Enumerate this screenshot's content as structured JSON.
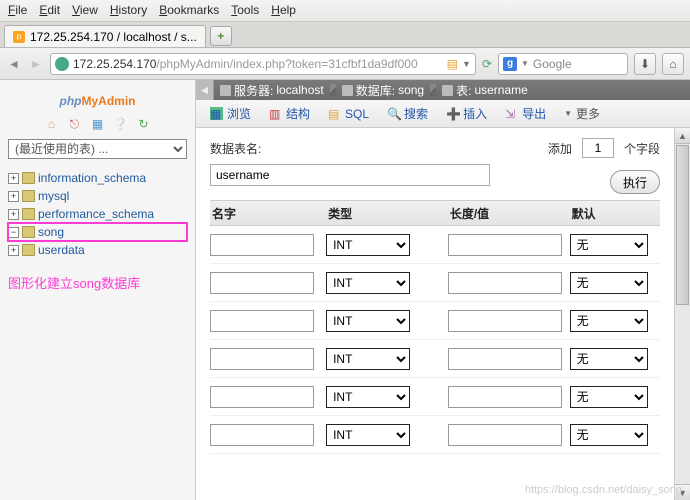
{
  "menu": {
    "file": "File",
    "edit": "Edit",
    "view": "View",
    "history": "History",
    "bookmarks": "Bookmarks",
    "tools": "Tools",
    "help": "Help"
  },
  "tab": {
    "title": "172.25.254.170 / localhost / s...",
    "add": "+"
  },
  "url": {
    "host": "172.25.254.170",
    "path": "/phpMyAdmin/index.php?token=31cfbf1da9df000",
    "search_engine": "Google",
    "g": "g"
  },
  "logo": {
    "p1": "php",
    "p2": "MyAdmin"
  },
  "mini_icons": {
    "home": "⌂",
    "logout": "🚪",
    "sql": "▦",
    "docs": "❔",
    "reload": "↻"
  },
  "recent_label": "(最近使用的表) ...",
  "databases": [
    {
      "name": "information_schema"
    },
    {
      "name": "mysql"
    },
    {
      "name": "performance_schema"
    },
    {
      "name": "song"
    },
    {
      "name": "userdata"
    }
  ],
  "selected_db_index": 3,
  "caption": "图形化建立song数据库",
  "breadcrumb": {
    "server_lbl": "服务器:",
    "server": "localhost",
    "db_lbl": "数据库:",
    "db": "song",
    "tbl_lbl": "表:",
    "tbl": "username"
  },
  "maintabs": {
    "browse": "浏览",
    "structure": "结构",
    "sql": "SQL",
    "search": "搜索",
    "insert": "插入",
    "export": "导出",
    "more": "更多"
  },
  "form": {
    "name_label": "数据表名:",
    "name_value": "username",
    "add_label": "添加",
    "add_count": "1",
    "fields_label": "个字段",
    "execute": "执行"
  },
  "grid": {
    "headers": {
      "name": "名字",
      "type": "类型",
      "length": "长度/值",
      "default": "默认"
    },
    "type_default": "INT",
    "def_default": "无",
    "rows": 6
  },
  "watermark": "https://blog.csdn.net/daisy_song"
}
